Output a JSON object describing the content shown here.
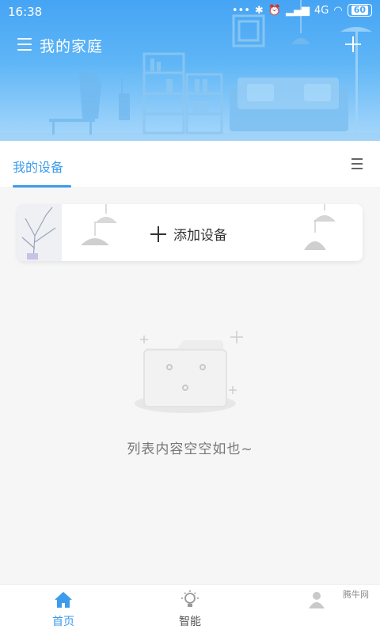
{
  "status_bar": {
    "time": "16:38",
    "network": "4G",
    "battery": "60"
  },
  "header": {
    "title": "我的家庭",
    "menu_icon": "hamburger-icon",
    "add_icon": "plus-icon"
  },
  "tabs": {
    "active_label": "我的设备"
  },
  "add_device": {
    "label": "添加设备"
  },
  "empty_state": {
    "message": "列表内容空空如也~"
  },
  "bottom_nav": {
    "items": [
      {
        "label": "首页",
        "icon": "home-icon",
        "active": true
      },
      {
        "label": "智能",
        "icon": "bulb-icon",
        "active": false
      },
      {
        "label": "",
        "icon": "user-icon",
        "active": false
      }
    ]
  },
  "watermark": "腾牛网",
  "colors": {
    "accent": "#3c9bea",
    "header_top": "#46a4f4",
    "header_bottom": "#a9d8fb"
  }
}
